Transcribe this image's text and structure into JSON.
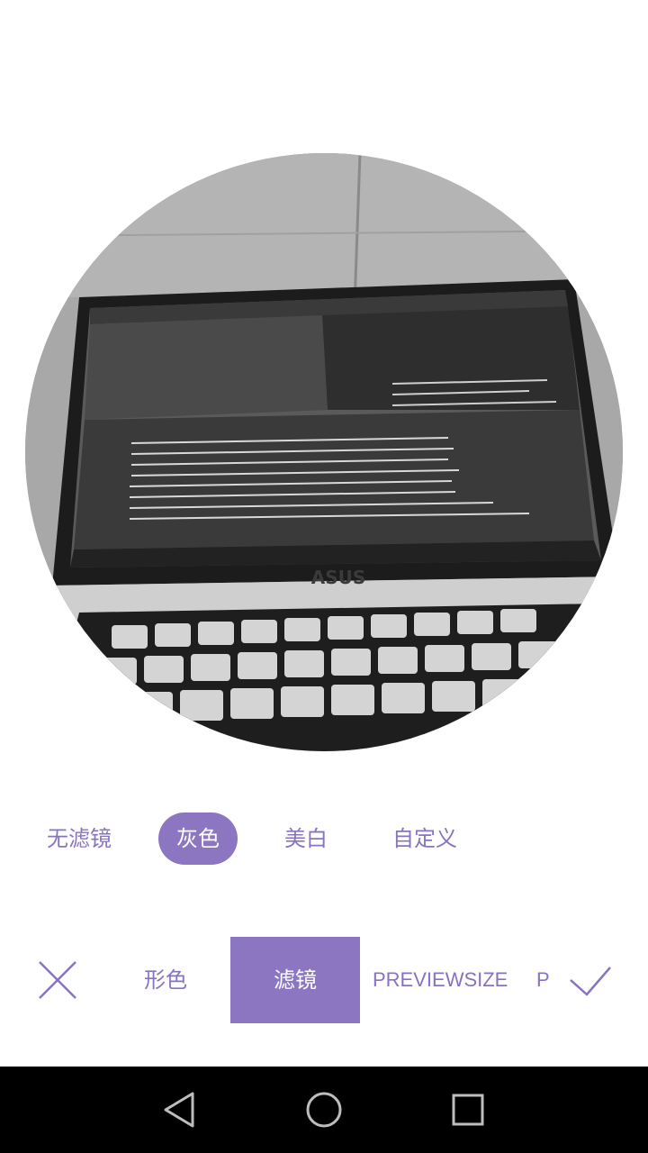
{
  "preview": {
    "brand_text": "ASUS"
  },
  "filters": {
    "items": [
      {
        "label": "无滤镜",
        "selected": false
      },
      {
        "label": "灰色",
        "selected": true
      },
      {
        "label": "美白",
        "selected": false
      },
      {
        "label": "自定义",
        "selected": false
      }
    ]
  },
  "tabs": {
    "items": [
      {
        "label": "形色",
        "selected": false
      },
      {
        "label": "滤镜",
        "selected": true
      },
      {
        "label": "PREVIEWSIZE",
        "selected": false
      },
      {
        "label": "P",
        "selected": false
      }
    ],
    "close_icon": "close-icon",
    "confirm_icon": "check-icon"
  },
  "navbar": {
    "back_icon": "back-triangle-icon",
    "home_icon": "home-circle-icon",
    "recents_icon": "recents-square-icon"
  },
  "colors": {
    "accent": "#8c76c2",
    "accent_text": "#8873c0",
    "navbar": "#000000"
  }
}
